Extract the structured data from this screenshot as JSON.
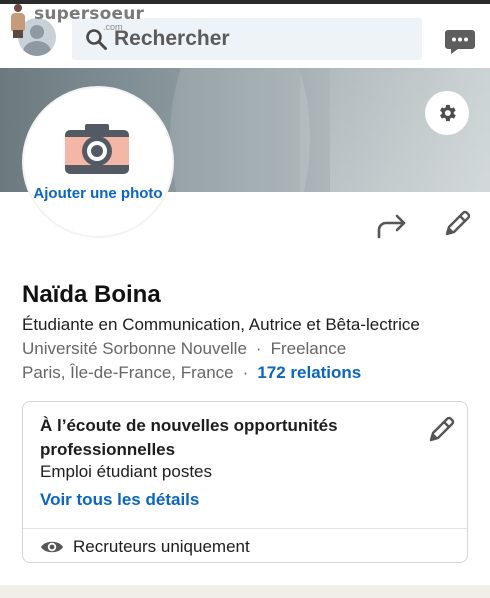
{
  "watermark": {
    "text": "supersoeur",
    "sub": ".com"
  },
  "header": {
    "search_placeholder": "Rechercher",
    "icons": {
      "avatar": "avatar",
      "search": "search-icon",
      "messages": "chat-bubble-icon"
    }
  },
  "banner": {
    "settings_icon": "gear-icon"
  },
  "photo": {
    "add_label": "Ajouter une photo",
    "icon": "camera-icon"
  },
  "actions": {
    "share_icon": "share-arrow-icon",
    "edit_icon": "pencil-icon"
  },
  "profile": {
    "name": "Naïda Boina",
    "headline": "Étudiante en Communication, Autrice et Bêta-lectrice",
    "school": "Université Sorbonne Nouvelle",
    "separator": "·",
    "work": "Freelance",
    "location": "Paris, Île-de-France, France",
    "relations": "172 relations"
  },
  "open_to_work": {
    "title": "À l’écoute de nouvelles opportunités professionnelles",
    "subtitle": "Emploi étudiant postes",
    "link": "Voir tous les détails",
    "visibility": "Recruteurs uniquement",
    "icons": {
      "edit": "pencil-icon",
      "visibility": "eye-icon"
    }
  },
  "colors": {
    "link": "#0a66c2",
    "search_bg": "#eef3f8",
    "camera_body": "#f4b6a6",
    "camera_dark": "#545a63"
  }
}
